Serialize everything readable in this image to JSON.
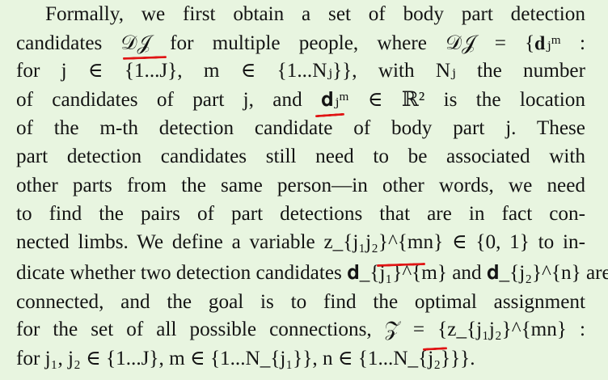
{
  "paragraph": {
    "lines": [
      "Formally, we first obtain a set of body part detection",
      "candidates 𝒟𝒥 for multiple people, where 𝒟𝒥 = {𝐝ⱼᵐ :",
      "for j ∈ {1...J}, m ∈ {1...Nⱼ}}, with Nⱼ the number",
      "of candidates of part j, and 𝐝ⱼᵐ ∈ ℝ² is the location",
      "of the m-th detection candidate of body part j. These",
      "part detection candidates still need to be associated with",
      "other parts from the same person—in other words, we need",
      "to find the pairs of part detections that are in fact con-",
      "nected limbs. We define a variable z_{j₁j₂}^{mn} ∈ {0, 1} to in-",
      "dicate whether two detection candidates 𝐝_{j₁}^{m} and 𝐝_{j₂}^{n} are",
      "connected, and the goal is to find the optimal assignment",
      "for the set of all possible connections, 𝒵 = {z_{j₁j₂}^{mn} :",
      "for j₁, j₂ ∈ {1...J}, m ∈ {1...N_{j₁}}, n ∈ {1...N_{j₂}}}."
    ]
  },
  "annotation_color": "#e01414",
  "background_color": "#e8f5e0"
}
